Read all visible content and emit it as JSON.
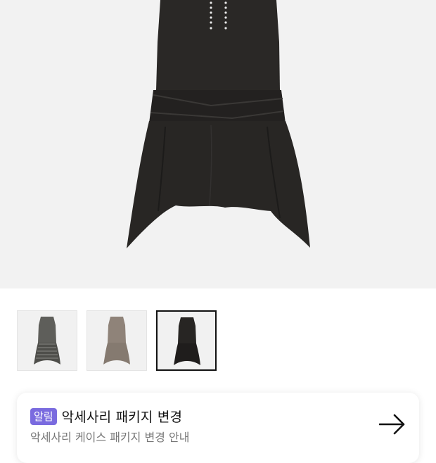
{
  "product": {
    "main_image": "black-sleeveless-dress-photo",
    "thumbnails": [
      {
        "label": "gray-checked-dress",
        "color": "#5e5e5a",
        "selected": false
      },
      {
        "label": "beige-dress",
        "color": "#8f8379",
        "selected": false
      },
      {
        "label": "black-dress",
        "color": "#272523",
        "selected": true
      }
    ]
  },
  "notice": {
    "badge": "알림",
    "title": "악세사리 패키지 변경",
    "subtitle": "악세사리 케이스 패키지 변경 안내",
    "icon": "arrow-right-icon"
  },
  "colors": {
    "badge": "#7a6bdf",
    "hero_background": "#f2f2f2"
  }
}
